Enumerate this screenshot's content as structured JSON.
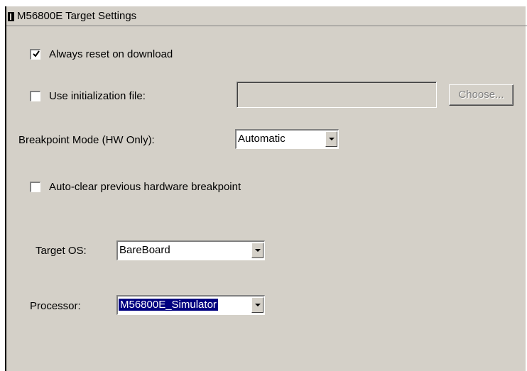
{
  "window": {
    "title": "M56800E Target Settings"
  },
  "options": {
    "always_reset": {
      "label": "Always reset on download",
      "checked": true
    },
    "use_init_file": {
      "label": "Use initialization file:",
      "checked": false,
      "path_value": ""
    },
    "choose_button": {
      "label": "Choose...",
      "enabled": false
    },
    "breakpoint_mode": {
      "label": "Breakpoint Mode (HW Only):",
      "value": "Automatic"
    },
    "auto_clear": {
      "label": "Auto-clear previous hardware breakpoint",
      "checked": false
    },
    "target_os": {
      "label": "Target OS:",
      "value": "BareBoard"
    },
    "processor": {
      "label": "Processor:",
      "value": "M56800E_Simulator"
    }
  },
  "icons": {
    "title": "window-icon",
    "check": "check-mark-icon",
    "dropdown": "chevron-down-icon"
  },
  "colors": {
    "dialog_bg": "#d4d0c8",
    "selection_bg": "#000080",
    "disabled_text": "#808080"
  }
}
